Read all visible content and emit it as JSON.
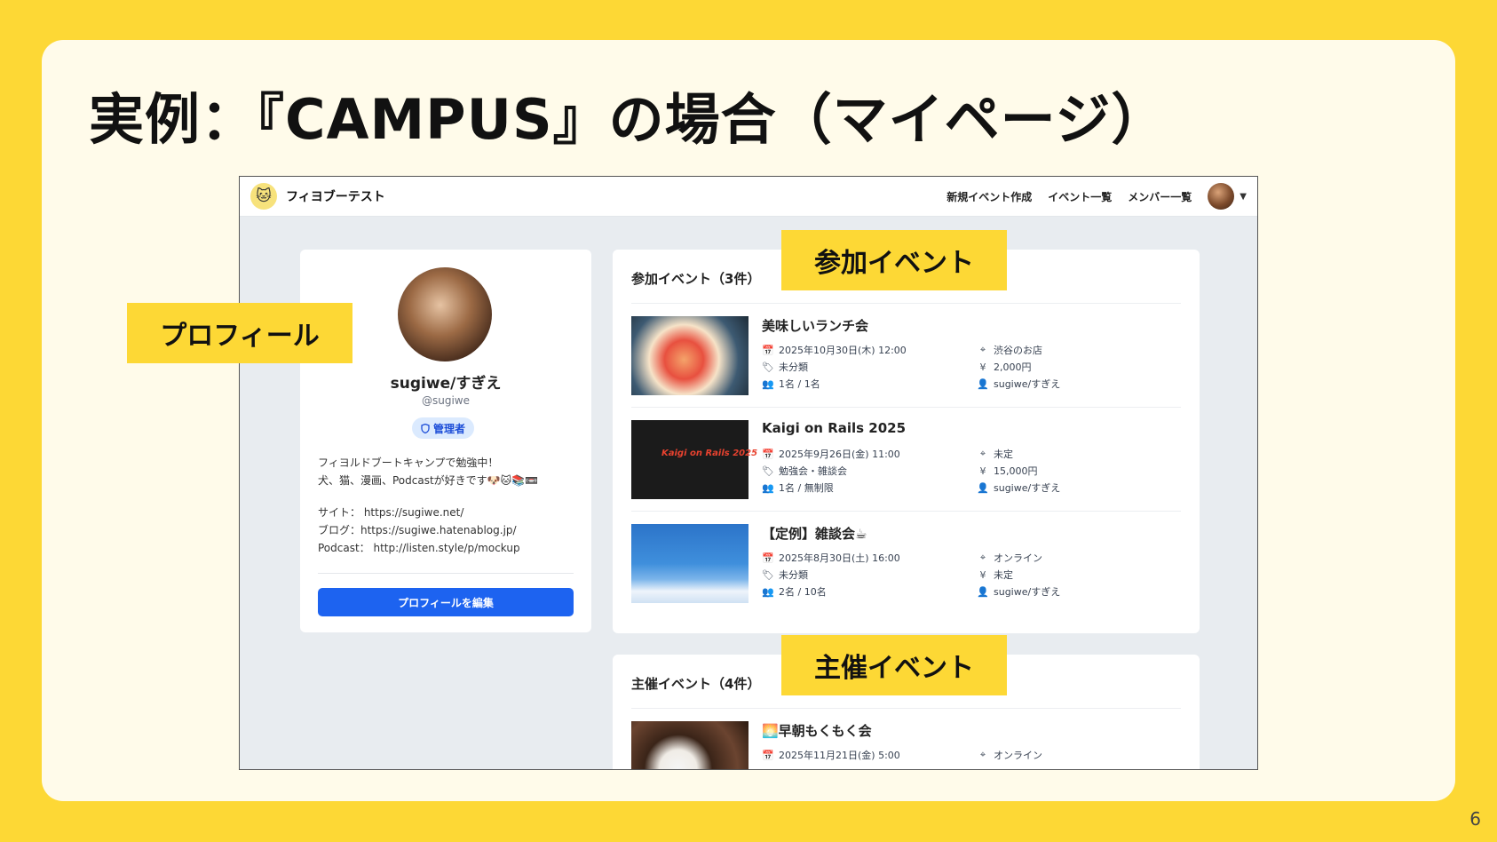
{
  "slide": {
    "title": "実例：『CAMPUS』の場合（マイページ）",
    "page_number": "6"
  },
  "callouts": {
    "profile": "プロフィール",
    "participating": "参加イベント",
    "hosted": "主催イベント"
  },
  "app": {
    "name": "フィヨブーテスト",
    "nav": {
      "create_event": "新規イベント作成",
      "event_list": "イベント一覧",
      "member_list": "メンバー一覧",
      "caret": "▼"
    }
  },
  "profile": {
    "name": "sugiwe/すぎえ",
    "handle": "@sugiwe",
    "role": "管理者",
    "bio": [
      "フィヨルドブートキャンプで勉強中！",
      "犬、猫、漫画、Podcastが好きです🐶🐱📚📼"
    ],
    "links": [
      "サイト： https://sugiwe.net/",
      "ブログ：https://sugiwe.hatenablog.jp/",
      "Podcast： http://listen.style/p/mockup"
    ],
    "edit_label": "プロフィールを編集"
  },
  "participating": {
    "heading": "参加イベント（3件）",
    "events": [
      {
        "title": "美味しいランチ会",
        "datetime": "2025年10月30日(木) 12:00",
        "category": "未分類",
        "capacity": "1名 / 1名",
        "place": "渋谷のお店",
        "fee": "2,000円",
        "organizer": "sugiwe/すぎえ"
      },
      {
        "title": "Kaigi on Rails 2025",
        "thumb_text": "Kaigi on Rails 2025",
        "datetime": "2025年9月26日(金) 11:00",
        "category": "勉強会・雑談会",
        "capacity": "1名 / 無制限",
        "place": "未定",
        "fee": "15,000円",
        "organizer": "sugiwe/すぎえ"
      },
      {
        "title": "【定例】雑談会☕",
        "datetime": "2025年8月30日(土) 16:00",
        "category": "未分類",
        "capacity": "2名 / 10名",
        "place": "オンライン",
        "fee": "未定",
        "organizer": "sugiwe/すぎえ"
      }
    ]
  },
  "hosted": {
    "heading": "主催イベント（4件）",
    "events": [
      {
        "title": "🌅早朝もくもく会",
        "datetime": "2025年11月21日(金) 5:00",
        "place": "オンライン"
      }
    ]
  },
  "icons": {
    "calendar": "calendar-icon",
    "tag": "tag-icon",
    "people": "people-icon",
    "location": "location-pin-icon",
    "fee": "money-bag-icon",
    "organizer": "person-icon",
    "shield": "shield-icon"
  },
  "colors": {
    "slide_background": "#FDD835",
    "card_background": "#FFFBEA",
    "primary_button": "#1D63F0",
    "badge_background": "#DBEAFE",
    "badge_text": "#1D4ED8"
  }
}
